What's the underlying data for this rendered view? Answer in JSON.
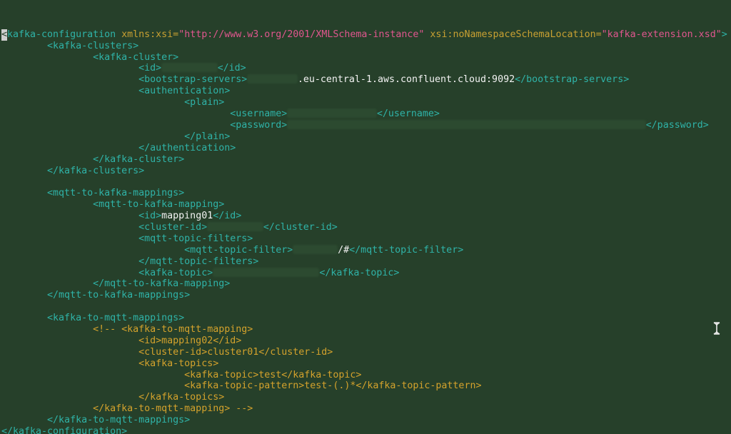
{
  "editor": {
    "lines": [
      {
        "cursor": "<",
        "segs": [
          [
            "tag",
            "kafka-configuration "
          ],
          [
            "attr",
            "xmlns:xsi="
          ],
          [
            "str",
            "\"http://www.w3.org/2001/XMLSchema-instance\""
          ],
          [
            "attr",
            " xsi:noNamespaceSchemaLocation="
          ],
          [
            "str",
            "\"kafka-extension.xsd\""
          ],
          [
            "tag",
            ">"
          ]
        ]
      },
      {
        "segs": [
          [
            "tag",
            "        <kafka-clusters>"
          ]
        ]
      },
      {
        "segs": [
          [
            "tag",
            "                <kafka-cluster>"
          ]
        ]
      },
      {
        "segs": [
          [
            "tag",
            "                        <id>"
          ],
          [
            "blur",
            10
          ],
          [
            "tag",
            "</id>"
          ]
        ]
      },
      {
        "segs": [
          [
            "tag",
            "                        <bootstrap-servers>"
          ],
          [
            "blur",
            9
          ],
          [
            "txt",
            ".eu-central-1.aws.confluent.cloud:9092"
          ],
          [
            "tag",
            "</bootstrap-servers>"
          ]
        ]
      },
      {
        "segs": [
          [
            "tag",
            "                        <authentication>"
          ]
        ]
      },
      {
        "segs": [
          [
            "tag",
            "                                <plain>"
          ]
        ]
      },
      {
        "segs": [
          [
            "tag",
            "                                        <username>"
          ],
          [
            "blur",
            16
          ],
          [
            "tag",
            "</username>"
          ]
        ]
      },
      {
        "segs": [
          [
            "tag",
            "                                        <password>"
          ],
          [
            "blur",
            64
          ],
          [
            "tag",
            "</password>"
          ]
        ]
      },
      {
        "segs": [
          [
            "tag",
            "                                </plain>"
          ]
        ]
      },
      {
        "segs": [
          [
            "tag",
            "                        </authentication>"
          ]
        ]
      },
      {
        "segs": [
          [
            "tag",
            "                </kafka-cluster>"
          ]
        ]
      },
      {
        "segs": [
          [
            "tag",
            "        </kafka-clusters>"
          ]
        ]
      },
      {
        "segs": []
      },
      {
        "segs": [
          [
            "tag",
            "        <mqtt-to-kafka-mappings>"
          ]
        ]
      },
      {
        "segs": [
          [
            "tag",
            "                <mqtt-to-kafka-mapping>"
          ]
        ]
      },
      {
        "segs": [
          [
            "tag",
            "                        <id>"
          ],
          [
            "txt",
            "mapping01"
          ],
          [
            "tag",
            "</id>"
          ]
        ]
      },
      {
        "segs": [
          [
            "tag",
            "                        <cluster-id>"
          ],
          [
            "blur",
            10
          ],
          [
            "tag",
            "</cluster-id>"
          ]
        ]
      },
      {
        "segs": [
          [
            "tag",
            "                        <mqtt-topic-filters>"
          ]
        ]
      },
      {
        "segs": [
          [
            "tag",
            "                                <mqtt-topic-filter>"
          ],
          [
            "blur",
            8
          ],
          [
            "txt",
            "/#"
          ],
          [
            "tag",
            "</mqtt-topic-filter>"
          ]
        ]
      },
      {
        "segs": [
          [
            "tag",
            "                        </mqtt-topic-filters>"
          ]
        ]
      },
      {
        "segs": [
          [
            "tag",
            "                        <kafka-topic>"
          ],
          [
            "blur",
            19
          ],
          [
            "tag",
            "</kafka-topic>"
          ]
        ]
      },
      {
        "segs": [
          [
            "tag",
            "                </mqtt-to-kafka-mapping>"
          ]
        ]
      },
      {
        "segs": [
          [
            "tag",
            "        </mqtt-to-kafka-mappings>"
          ]
        ]
      },
      {
        "segs": []
      },
      {
        "segs": [
          [
            "tag",
            "        <kafka-to-mqtt-mappings>"
          ]
        ]
      },
      {
        "segs": [
          [
            "comment",
            "                <!-- <kafka-to-mqtt-mapping>"
          ]
        ]
      },
      {
        "segs": [
          [
            "comment",
            "                        <id>mapping02</id>"
          ]
        ]
      },
      {
        "segs": [
          [
            "comment",
            "                        <cluster-id>cluster01</cluster-id>"
          ]
        ]
      },
      {
        "segs": [
          [
            "comment",
            "                        <kafka-topics>"
          ]
        ]
      },
      {
        "segs": [
          [
            "comment",
            "                                <kafka-topic>test</kafka-topic>"
          ]
        ]
      },
      {
        "segs": [
          [
            "comment",
            "                                <kafka-topic-pattern>test-(.)*</kafka-topic-pattern>"
          ]
        ]
      },
      {
        "segs": [
          [
            "comment",
            "                        </kafka-topics>"
          ]
        ]
      },
      {
        "segs": [
          [
            "comment",
            "                </kafka-to-mqtt-mapping> -->"
          ]
        ]
      },
      {
        "segs": [
          [
            "tag",
            "        </kafka-to-mqtt-mappings>"
          ]
        ]
      },
      {
        "segs": [
          [
            "tag",
            "</kafka-configuration>"
          ]
        ]
      }
    ]
  },
  "colors": {
    "background": "#26402a",
    "tag": "#2fb3a8",
    "attribute": "#c8a032",
    "string": "#e0568e",
    "text": "#f2f2f2",
    "comment": "#d4a22c"
  },
  "icons": {
    "mouse_pointer": "text-ibeam-icon"
  }
}
